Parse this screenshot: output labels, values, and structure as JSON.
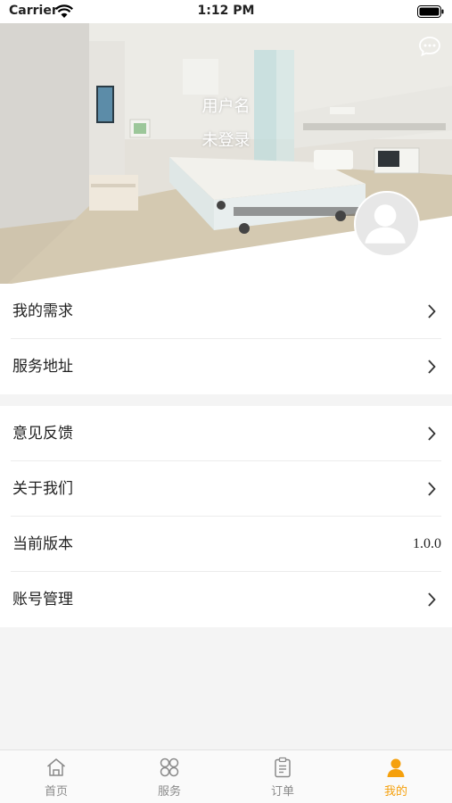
{
  "status_bar": {
    "carrier": "Carrier",
    "time": "1:12 PM"
  },
  "header": {
    "username": "用户名",
    "login_state": "未登录",
    "chat_icon": "chat-bubble-icon",
    "avatar_icon": "user-avatar-icon"
  },
  "menu": {
    "group1": [
      {
        "label": "我的需求",
        "icon": "chevron-right-icon"
      },
      {
        "label": "服务地址",
        "icon": "chevron-right-icon"
      }
    ],
    "group2": [
      {
        "label": "意见反馈",
        "icon": "chevron-right-icon"
      },
      {
        "label": "关于我们",
        "icon": "chevron-right-icon"
      },
      {
        "label": "当前版本",
        "value": "1.0.0"
      },
      {
        "label": "账号管理",
        "icon": "chevron-right-icon"
      }
    ]
  },
  "tabbar": {
    "tabs": [
      {
        "label": "首页",
        "icon": "home-icon",
        "active": false
      },
      {
        "label": "服务",
        "icon": "grid-clover-icon",
        "active": false
      },
      {
        "label": "订单",
        "icon": "clipboard-icon",
        "active": false
      },
      {
        "label": "我的",
        "icon": "person-icon",
        "active": true
      }
    ]
  },
  "colors": {
    "accent": "#f5a00c",
    "tab_inactive": "#8a8a8a",
    "background": "#f4f4f4"
  }
}
